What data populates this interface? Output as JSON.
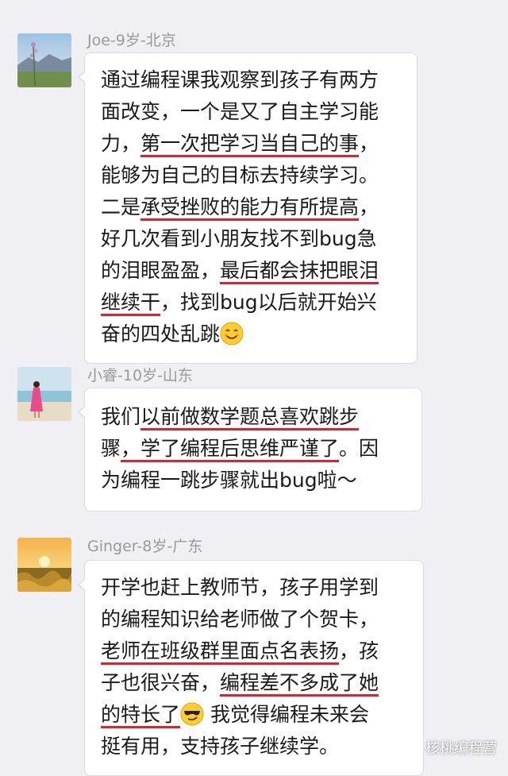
{
  "messages": [
    {
      "name": "Joe-9岁-北京",
      "avatar": "avatar-mountain-flower",
      "lines": [
        {
          "segments": [
            {
              "t": "通过编程课我观察到孩子有两方",
              "u": false
            }
          ]
        },
        {
          "segments": [
            {
              "t": "面改变，一个是又了自主学习能",
              "u": false
            }
          ]
        },
        {
          "segments": [
            {
              "t": "力，",
              "u": false
            },
            {
              "t": "第一次把学习当自己的事",
              "u": true
            },
            {
              "t": "，",
              "u": false
            }
          ]
        },
        {
          "segments": [
            {
              "t": "能够为自己的目标去持续学习。",
              "u": false
            }
          ]
        },
        {
          "segments": [
            {
              "t": "二是",
              "u": false
            },
            {
              "t": "承受挫败的能力有所提高",
              "u": true
            },
            {
              "t": "，",
              "u": false
            }
          ]
        },
        {
          "segments": [
            {
              "t": "好几次看到小朋友找不到bug急",
              "u": false
            }
          ]
        },
        {
          "segments": [
            {
              "t": "的泪眼盈盈，",
              "u": false
            },
            {
              "t": "最后都会抹把眼泪",
              "u": true
            }
          ]
        },
        {
          "segments": [
            {
              "t": "继续干",
              "u": true
            },
            {
              "t": "，找到bug以后就开始兴",
              "u": false
            }
          ]
        },
        {
          "segments": [
            {
              "t": "奋的四处乱跳",
              "u": false
            }
          ],
          "emoji": "smiling-face-emoji"
        }
      ]
    },
    {
      "name": "小睿-10岁-山东",
      "avatar": "avatar-girl-beach",
      "lines": [
        {
          "segments": [
            {
              "t": "我们",
              "u": false
            },
            {
              "t": "以前做数学题总喜欢跳步",
              "u": true
            }
          ]
        },
        {
          "segments": [
            {
              "t": "骤",
              "u": false
            },
            {
              "t": "，学了编程后思维严谨了",
              "u": true
            },
            {
              "t": "。因",
              "u": false
            }
          ]
        },
        {
          "segments": [
            {
              "t": "为编程一跳步骤就出bug啦～",
              "u": false
            }
          ]
        }
      ]
    },
    {
      "name": "Ginger-8岁-广东",
      "avatar": "avatar-sunset-field",
      "lines": [
        {
          "segments": [
            {
              "t": "开学也赶上教师节，孩子用学到",
              "u": false
            }
          ]
        },
        {
          "segments": [
            {
              "t": "的编程知识给老师做了个贺卡，",
              "u": false
            }
          ]
        },
        {
          "segments": [
            {
              "t": "老师在班级群里面点名表扬",
              "u": true
            },
            {
              "t": "，孩",
              "u": false
            }
          ]
        },
        {
          "segments": [
            {
              "t": "子也很兴奋，",
              "u": false
            },
            {
              "t": "编程差不多成了她",
              "u": true
            }
          ]
        },
        {
          "segments": [
            {
              "t": "的特长了",
              "u": true
            }
          ],
          "emoji": "sunglasses-emoji",
          "after": " 我觉得编程未来会"
        },
        {
          "segments": [
            {
              "t": "挺有用，支持孩子继续学。",
              "u": false
            }
          ]
        }
      ]
    }
  ],
  "watermark": {
    "label": "核桃编程营",
    "icon": "wechat-icon"
  },
  "colors": {
    "underline": "#e0212b",
    "background": "#efeff4",
    "bubble": "#ffffff",
    "name": "#9a9a9a"
  }
}
